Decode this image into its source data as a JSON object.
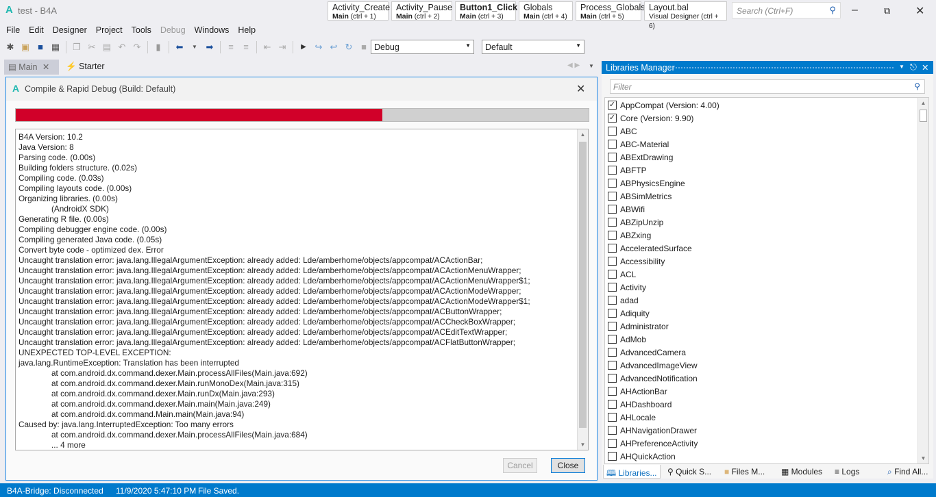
{
  "window": {
    "logo": "A",
    "title": "test - B4A",
    "search_placeholder": "Search (Ctrl+F)"
  },
  "quick_tabs": [
    {
      "name": "Activity_Create",
      "module": "Main",
      "shortcut": "(ctrl + 1)",
      "bold": false
    },
    {
      "name": "Activity_Pause",
      "module": "Main",
      "shortcut": "(ctrl + 2)",
      "bold": false
    },
    {
      "name": "Button1_Click",
      "module": "Main",
      "shortcut": "(ctrl + 3)",
      "bold": true
    },
    {
      "name": "Globals",
      "module": "Main",
      "shortcut": "(ctrl + 4)",
      "bold": false
    },
    {
      "name": "Process_Globals",
      "module": "Main",
      "shortcut": "(ctrl + 5)",
      "bold": false
    },
    {
      "name": "Layout.bal",
      "module": "Visual Designer",
      "shortcut": "(ctrl + 6)",
      "bold": false
    }
  ],
  "menu": [
    {
      "label": "File"
    },
    {
      "label": "Edit"
    },
    {
      "label": "Designer"
    },
    {
      "label": "Project"
    },
    {
      "label": "Tools"
    },
    {
      "label": "Debug",
      "disabled": true
    },
    {
      "label": "Windows"
    },
    {
      "label": "Help"
    }
  ],
  "toolbar": {
    "build_config": "Debug",
    "build_target": "Default"
  },
  "doc_tabs": [
    {
      "label": "Main"
    },
    {
      "label": "Starter"
    }
  ],
  "dialog": {
    "logo": "A",
    "title": "Compile & Rapid Debug (Build: Default)",
    "progress_percent": 64,
    "progress_color": "#d10029",
    "cancel_label": "Cancel",
    "close_label": "Close",
    "log": [
      {
        "text": "B4A Version: 10.2"
      },
      {
        "text": "Java Version: 8"
      },
      {
        "text": "Parsing code.    (0.00s)"
      },
      {
        "text": "Building folders structure.    (0.02s)"
      },
      {
        "text": "Compiling code.    (0.03s)"
      },
      {
        "text": "Compiling layouts code.    (0.00s)"
      },
      {
        "text": "Organizing libraries.    (0.00s)"
      },
      {
        "text": "(AndroidX SDK)",
        "indent": true
      },
      {
        "text": "Generating R file.    (0.00s)"
      },
      {
        "text": "Compiling debugger engine code.    (0.00s)"
      },
      {
        "text": "Compiling generated Java code.    (0.05s)"
      },
      {
        "text": "Convert byte code - optimized dex.    Error"
      },
      {
        "text": "Uncaught translation error: java.lang.IllegalArgumentException: already added: Lde/amberhome/objects/appcompat/ACActionBar;"
      },
      {
        "text": "Uncaught translation error: java.lang.IllegalArgumentException: already added: Lde/amberhome/objects/appcompat/ACActionMenuWrapper;"
      },
      {
        "text": "Uncaught translation error: java.lang.IllegalArgumentException: already added: Lde/amberhome/objects/appcompat/ACActionMenuWrapper$1;"
      },
      {
        "text": "Uncaught translation error: java.lang.IllegalArgumentException: already added: Lde/amberhome/objects/appcompat/ACActionModeWrapper;"
      },
      {
        "text": "Uncaught translation error: java.lang.IllegalArgumentException: already added: Lde/amberhome/objects/appcompat/ACActionModeWrapper$1;"
      },
      {
        "text": "Uncaught translation error: java.lang.IllegalArgumentException: already added: Lde/amberhome/objects/appcompat/ACButtonWrapper;"
      },
      {
        "text": "Uncaught translation error: java.lang.IllegalArgumentException: already added: Lde/amberhome/objects/appcompat/ACCheckBoxWrapper;"
      },
      {
        "text": "Uncaught translation error: java.lang.IllegalArgumentException: already added: Lde/amberhome/objects/appcompat/ACEditTextWrapper;"
      },
      {
        "text": "Uncaught translation error: java.lang.IllegalArgumentException: already added: Lde/amberhome/objects/appcompat/ACFlatButtonWrapper;"
      },
      {
        "text": "UNEXPECTED TOP-LEVEL EXCEPTION:"
      },
      {
        "text": "java.lang.RuntimeException: Translation has been interrupted"
      },
      {
        "text": "at com.android.dx.command.dexer.Main.processAllFiles(Main.java:692)",
        "indent": true
      },
      {
        "text": "at com.android.dx.command.dexer.Main.runMonoDex(Main.java:315)",
        "indent": true
      },
      {
        "text": "at com.android.dx.command.dexer.Main.runDx(Main.java:293)",
        "indent": true
      },
      {
        "text": "at com.android.dx.command.dexer.Main.main(Main.java:249)",
        "indent": true
      },
      {
        "text": "at com.android.dx.command.Main.main(Main.java:94)",
        "indent": true
      },
      {
        "text": "Caused by: java.lang.InterruptedException: Too many errors"
      },
      {
        "text": "at com.android.dx.command.dexer.Main.processAllFiles(Main.java:684)",
        "indent": true
      },
      {
        "text": "... 4 more",
        "indent": true
      }
    ]
  },
  "libraries": {
    "title": "Libraries Manager",
    "filter_placeholder": "Filter",
    "items": [
      {
        "name": "AppCompat (Version: 4.00)",
        "checked": true
      },
      {
        "name": "Core (Version: 9.90)",
        "checked": true
      },
      {
        "name": "ABC"
      },
      {
        "name": "ABC-Material"
      },
      {
        "name": "ABExtDrawing"
      },
      {
        "name": "ABFTP"
      },
      {
        "name": "ABPhysicsEngine"
      },
      {
        "name": "ABSimMetrics"
      },
      {
        "name": "ABWifi"
      },
      {
        "name": "ABZipUnzip"
      },
      {
        "name": "ABZxing"
      },
      {
        "name": "AcceleratedSurface"
      },
      {
        "name": "Accessibility"
      },
      {
        "name": "ACL"
      },
      {
        "name": "Activity"
      },
      {
        "name": "adad"
      },
      {
        "name": "Adiquity"
      },
      {
        "name": "Administrator"
      },
      {
        "name": "AdMob"
      },
      {
        "name": "AdvancedCamera"
      },
      {
        "name": "AdvancedImageView"
      },
      {
        "name": "AdvancedNotification"
      },
      {
        "name": "AHActionBar"
      },
      {
        "name": "AHDashboard"
      },
      {
        "name": "AHLocale"
      },
      {
        "name": "AHNavigationDrawer"
      },
      {
        "name": "AHPreferenceActivity"
      },
      {
        "name": "AHQuickAction"
      }
    ]
  },
  "bottom_tabs": [
    {
      "label": "Libraries...",
      "icon": "book-icon"
    },
    {
      "label": "Quick S...",
      "icon": "search-icon"
    },
    {
      "label": "Files M...",
      "icon": "folder-icon"
    },
    {
      "label": "Modules",
      "icon": "modules-icon"
    },
    {
      "label": "Logs",
      "icon": "logs-icon"
    },
    {
      "label": "Find All...",
      "icon": "find-icon"
    }
  ],
  "status": {
    "bridge": "B4A-Bridge: Disconnected",
    "datetime": "11/9/2020 5:47:10 PM",
    "message": "File Saved."
  },
  "colors": {
    "accent": "#007acc",
    "progress": "#d10029"
  }
}
